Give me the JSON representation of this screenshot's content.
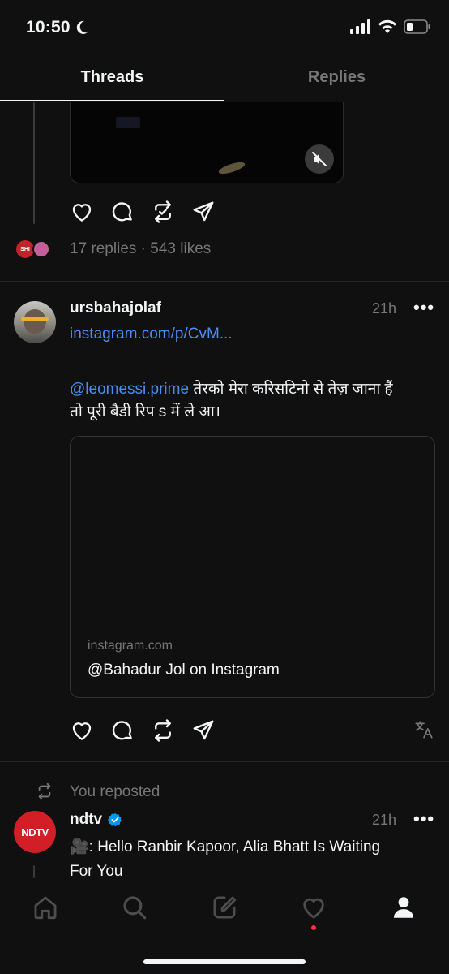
{
  "status_bar": {
    "time": "10:50"
  },
  "tabs": [
    {
      "label": "Threads",
      "active": true
    },
    {
      "label": "Replies",
      "active": false
    }
  ],
  "post1": {
    "stats": "17 replies · 543 likes",
    "avatar_text": "SHI"
  },
  "post2": {
    "username": "ursbahajolaf",
    "time": "21h",
    "more": "•••",
    "link": "instagram.com/p/CvM...",
    "mention": "@leomessi.prime",
    "text_line1": " तेरको मेरा करिसटिनो से तेज़ जाना हैं",
    "text_line2": "तो पूरी बैडी रिप s में ले आ।",
    "card": {
      "domain": "instagram.com",
      "title": "@Bahadur Jol on Instagram"
    }
  },
  "repost": {
    "label": "You reposted",
    "username": "ndtv",
    "avatar_text": "NDTV",
    "time": "21h",
    "more": "•••",
    "text_line1": "🎥: Hello Ranbir Kapoor, Alia Bhatt Is Waiting",
    "text_line2": "For You"
  },
  "colors": {
    "background": "#101010",
    "link": "#4a8ef5",
    "muted": "#777777",
    "verified": "#0095f6",
    "ndtv_red": "#d21f27",
    "notification": "#ff3040"
  },
  "icons": [
    "moon-icon",
    "signal-icon",
    "wifi-icon",
    "battery-icon",
    "heart-icon",
    "comment-icon",
    "repost-icon",
    "share-icon",
    "translate-icon",
    "mute-icon",
    "home-icon",
    "search-icon",
    "compose-icon",
    "activity-icon",
    "profile-icon",
    "verified-icon"
  ]
}
